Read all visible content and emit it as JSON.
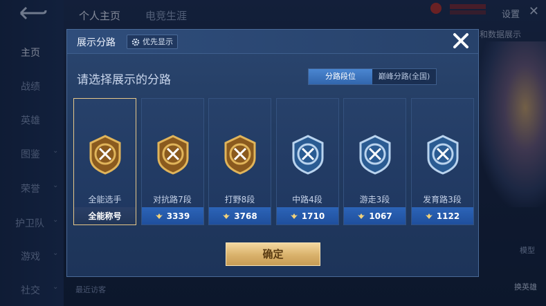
{
  "background": {
    "sidebar_items": [
      {
        "label": "主页",
        "chevron": ""
      },
      {
        "label": "战绩",
        "chevron": ""
      },
      {
        "label": "英雄",
        "chevron": ""
      },
      {
        "label": "图鉴",
        "chevron": "⌄"
      },
      {
        "label": "荣誉",
        "chevron": "⌄"
      },
      {
        "label": "护卫队",
        "chevron": "⌄"
      },
      {
        "label": "游戏",
        "chevron": "⌄"
      },
      {
        "label": "社交",
        "chevron": "⌄"
      }
    ],
    "tabs": [
      "个人主页",
      "电竞生涯"
    ],
    "settings": "设置",
    "hint_text": "和数据展示",
    "visitors": "最近访客",
    "model_label": "模型",
    "swap_hero": "换英雄"
  },
  "modal": {
    "title": "展示分路",
    "priority_button": "优先显示",
    "subtitle": "请选择展示的分路",
    "toggle": {
      "left": "分路段位",
      "right": "巅峰分路(全国)",
      "active": "left"
    },
    "cards": [
      {
        "name": "全能选手",
        "footer": "全能称号",
        "selected": true,
        "tier": "gold",
        "icon": "all-round-emblem-icon"
      },
      {
        "name": "对抗路7段",
        "footer": "3339",
        "selected": false,
        "tier": "gold",
        "icon": "clash-lane-emblem-icon"
      },
      {
        "name": "打野8段",
        "footer": "3768",
        "selected": false,
        "tier": "gold",
        "icon": "jungle-emblem-icon"
      },
      {
        "name": "中路4段",
        "footer": "1710",
        "selected": false,
        "tier": "silver",
        "icon": "mid-lane-emblem-icon"
      },
      {
        "name": "游走3段",
        "footer": "1067",
        "selected": false,
        "tier": "silver",
        "icon": "roam-emblem-icon"
      },
      {
        "name": "发育路3段",
        "footer": "1122",
        "selected": false,
        "tier": "silver",
        "icon": "farm-lane-emblem-icon"
      }
    ],
    "confirm": "确定"
  },
  "colors": {
    "gold": "#e0b45a",
    "silver": "#b9d3ee",
    "accent_blue": "#3266ad"
  }
}
